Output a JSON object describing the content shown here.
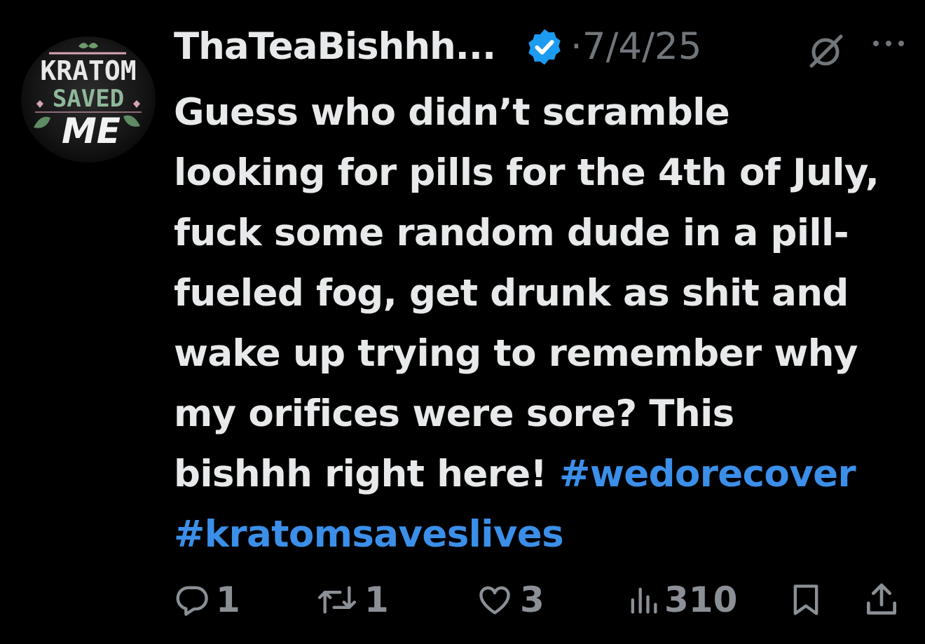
{
  "author": {
    "display_name": "ThaTeaBishhh...",
    "verified": true,
    "avatar_text": [
      "KRATOM",
      "SAVED",
      "ME"
    ]
  },
  "post": {
    "separator": "·",
    "date": "7/4/25",
    "lines": [
      "Guess who didn’t scramble",
      "looking for pills for the 4th of July,",
      "fuck some random dude in a pill-",
      "fueled fog, get drunk as shit and",
      "wake up trying to remember why",
      "my orifices were sore? This"
    ],
    "last_line_text": "bishhh right here! ",
    "hashtags": [
      "#wedorecover",
      "#kratomsaveslives"
    ]
  },
  "actions": {
    "replies": "1",
    "reposts": "1",
    "likes": "3",
    "views": "310"
  },
  "icons": {
    "verified": "verified-badge-icon",
    "grok": "grok-icon",
    "more": "more-icon",
    "reply": "reply-icon",
    "repost": "repost-icon",
    "like": "heart-icon",
    "views": "views-icon",
    "bookmark": "bookmark-icon",
    "share": "share-icon"
  },
  "colors": {
    "background": "#000000",
    "text": "#e7e9ea",
    "secondary": "#71767b",
    "hashtag": "#3b8fe8",
    "verified": "#1d9bf0"
  }
}
